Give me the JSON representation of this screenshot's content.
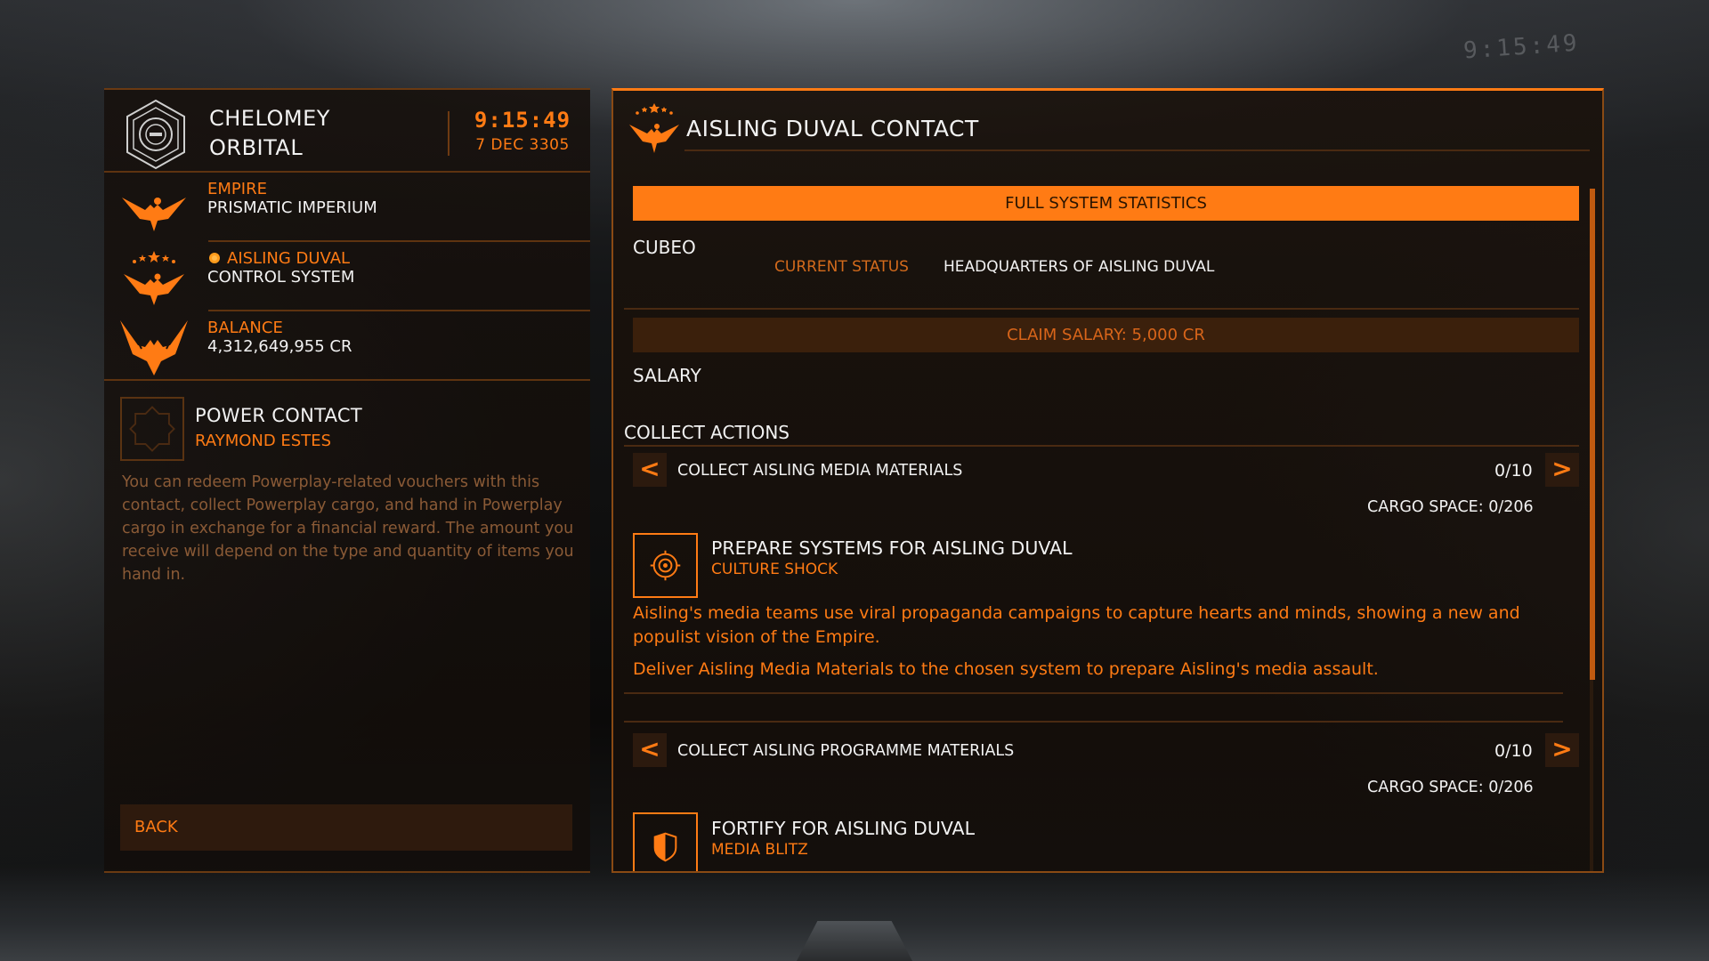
{
  "background": {
    "hud_clock": "9:15:49"
  },
  "left": {
    "station": {
      "name": "CHELOMEY\nORBITAL",
      "time": "9:15:49",
      "date": "7 DEC 3305"
    },
    "allegiance": {
      "label": "EMPIRE",
      "value": "PRISMATIC IMPERIUM"
    },
    "power": {
      "label": "AISLING DUVAL",
      "value": "CONTROL SYSTEM"
    },
    "balance": {
      "label": "BALANCE",
      "value": "4,312,649,955 CR"
    },
    "contact": {
      "title": "POWER CONTACT",
      "name": "RAYMOND ESTES",
      "description": "You can redeem Powerplay-related vouchers with this contact, collect Powerplay cargo, and hand in Powerplay cargo in exchange for a financial reward. The amount you receive will depend on the type and quantity of items you hand in."
    },
    "back_label": "BACK"
  },
  "right": {
    "title": "AISLING DUVAL CONTACT",
    "stats_button": "FULL SYSTEM STATISTICS",
    "system": {
      "name": "CUBEO",
      "status_label": "CURRENT STATUS",
      "status_value": "HEADQUARTERS OF AISLING DUVAL"
    },
    "salary_button": "CLAIM SALARY: 5,000 CR",
    "salary_label": "SALARY",
    "collect_heading": "COLLECT ACTIONS",
    "actions": [
      {
        "label": "COLLECT AISLING MEDIA MATERIALS",
        "count": "0/10",
        "cargo": "CARGO SPACE: 0/206",
        "task_title": "PREPARE SYSTEMS FOR AISLING DUVAL",
        "task_sub": "CULTURE SHOCK",
        "task_icon": "target-icon",
        "desc1": "Aisling's media teams use viral propaganda campaigns to capture hearts and minds, showing a new and populist vision of the Empire.",
        "desc2": "Deliver Aisling Media Materials to the chosen system to prepare Aisling's media assault."
      },
      {
        "label": "COLLECT AISLING PROGRAMME MATERIALS",
        "count": "0/10",
        "cargo": "CARGO SPACE: 0/206",
        "task_title": "FORTIFY FOR AISLING DUVAL",
        "task_sub": "MEDIA BLITZ",
        "task_icon": "shield-icon"
      }
    ],
    "arrow_left": "<",
    "arrow_right": ">"
  },
  "colors": {
    "accent": "#ff7b14",
    "dim_accent": "#d26a1c",
    "panel_line": "#5e3310"
  }
}
